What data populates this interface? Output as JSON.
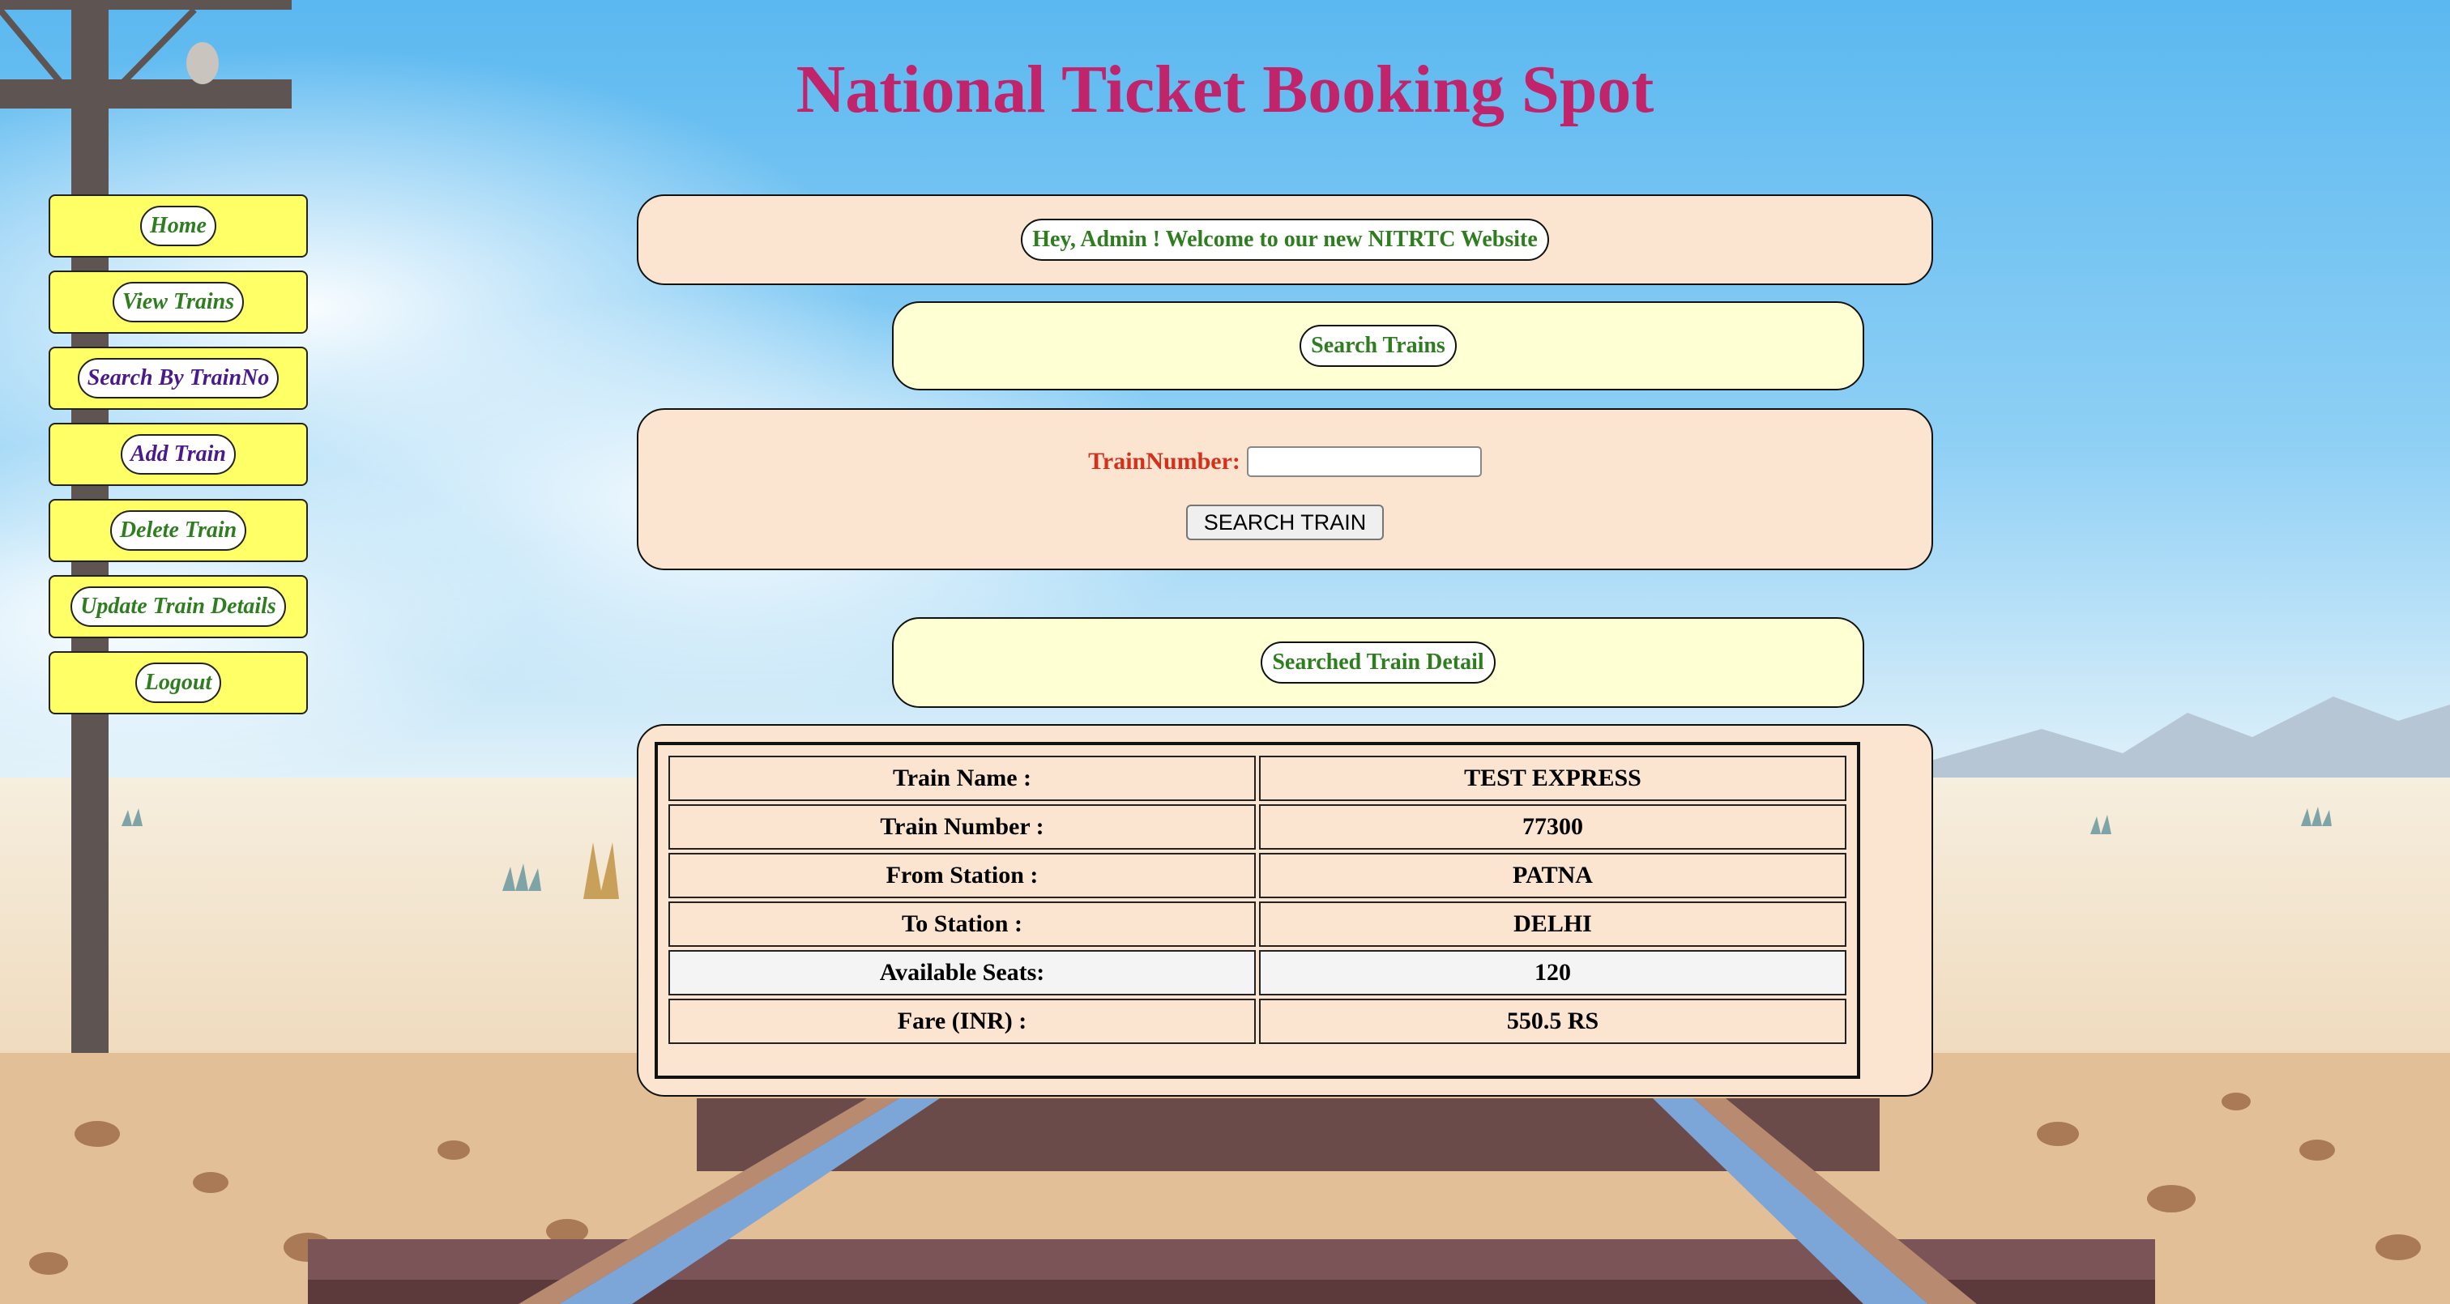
{
  "page": {
    "title": "National Ticket Booking Spot"
  },
  "sidebar": {
    "items": [
      {
        "label": "Home",
        "color": "#2e7d1f"
      },
      {
        "label": "View Trains",
        "color": "#2e7d1f"
      },
      {
        "label": "Search By TrainNo",
        "color": "#4a1a8c"
      },
      {
        "label": "Add Train",
        "color": "#4a1a8c"
      },
      {
        "label": "Delete Train",
        "color": "#2e7d1f"
      },
      {
        "label": "Update Train Details",
        "color": "#2e7d1f"
      },
      {
        "label": "Logout",
        "color": "#2e7d1f"
      }
    ]
  },
  "welcome": {
    "text": "Hey, Admin ! Welcome to our new NITRTC Website"
  },
  "search_section": {
    "heading": "Search Trains",
    "field_label": "TrainNumber:",
    "field_value": "",
    "button_label": "SEARCH TRAIN"
  },
  "detail_section": {
    "heading": "Searched Train Detail",
    "rows": [
      {
        "label": "Train Name :",
        "value": "TEST EXPRESS"
      },
      {
        "label": "Train Number :",
        "value": "77300"
      },
      {
        "label": "From Station :",
        "value": "PATNA"
      },
      {
        "label": "To Station :",
        "value": "DELHI"
      },
      {
        "label": "Available Seats:",
        "value": "120"
      },
      {
        "label": "Fare (INR) :",
        "value": "550.5 RS"
      }
    ]
  },
  "colors": {
    "title": "#c0246a",
    "sidebar_bg": "#ffff66",
    "panel_peach": "#fbe5d0",
    "panel_cream": "#ffffd4",
    "label_red": "#d4301c",
    "text_green": "#2e7d1f"
  }
}
